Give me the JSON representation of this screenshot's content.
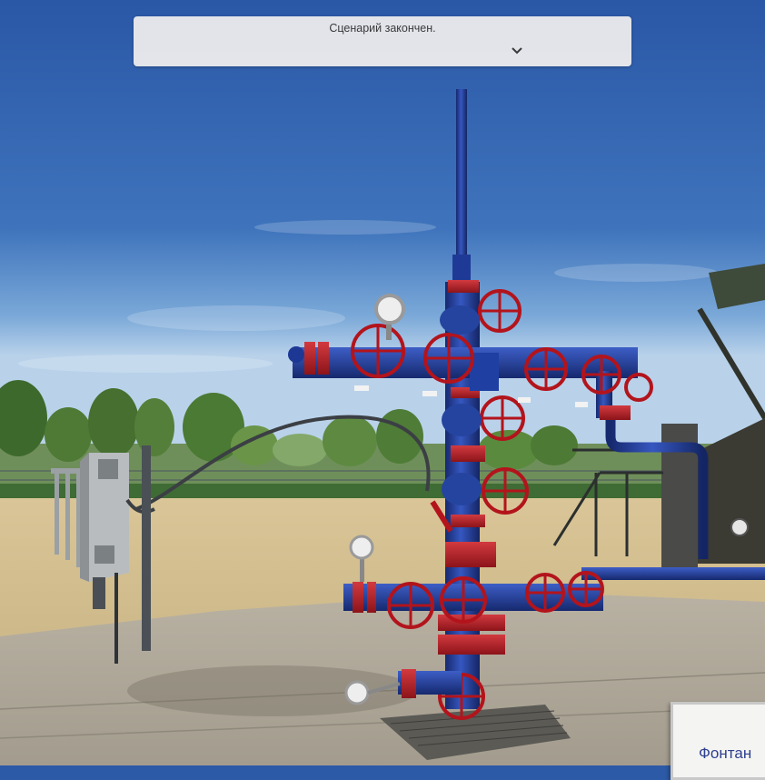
{
  "notification": {
    "message": "Сценарий закончен.",
    "toggle_icon": "chevron-down-icon"
  },
  "scene": {
    "description_kind": "3d-simulation-viewport",
    "sign_text": "Фонтан",
    "colors": {
      "sky_top": "#2a5aa8",
      "pipe_blue": "#233f9c",
      "valve_red": "#b51f27",
      "ground": "#cdb98a"
    }
  }
}
